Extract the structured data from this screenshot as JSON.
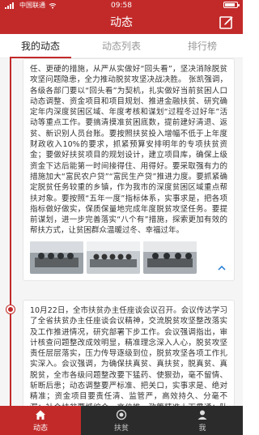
{
  "status_bar": {
    "carrier": "中国联通",
    "time": "09:58",
    "battery_percent": 85
  },
  "header": {
    "title": "动态"
  },
  "tabs": [
    {
      "label": "我的动态"
    },
    {
      "label": "动态列表"
    },
    {
      "label": "排行榜"
    }
  ],
  "posts": [
    {
      "text": "任、更硬的措施，从严从实做好“回头看”，坚决消除脱贫攻坚问题隐患，全力推动脱贫攻坚决战决胜。 张凯强调，各级各部门要以“回头看”为契机，扎实做好当前贫困人口动态调整、资金项目和项目规划、推进金融扶贫、研究确定年内深度贫困区域、年度考核和谋划“过程冬过好年”活动等重点工作。要搞清摸准贫困底数，提前建好清退、返贫、新识别人员台账。要按照扶贫投入增幅不低于上年度财政收入10%的要求，抓紧预算安排明年的专项扶贫资金；要做好扶贫项目的规划设计，建立项目库，确保上级资金下达后能第一时间接得住、用得好。要采取强有力的措施加大“富民农户贷”“富民生产贷”推进力度。要抓紧确定脱贫任务较重的乡镇，作为我市的深度贫困区域重点帮扶对象。要按照“五年一度”指标体系，实事求是，把各项指标做好做实，保质保量地完成年度脱贫攻坚任务。要提前谋划，进一步完善落实“八个有”措施，探索更加有效的帮扶方式，让贫困群众温暖过冬、幸福过年。",
      "images": [
        "meeting-photo-1",
        "meeting-photo-2",
        "meeting-photo-3"
      ]
    },
    {
      "text": "10月22日，全市扶贫办主任座谈会议召开。会议传达学习了全省扶贫办主任座谈会议精神，交流脱贫攻坚整改落实及工作推进情况，研究部署下步工作。会议强调指出，审计核查问题整改成效明显，精准理念深入人心，脱贫攻坚责任层层落实，压力传导逐级到位，脱贫攻坚各项工作扎实深入。会议强调，为确保扶真贫、真扶贫，脱真贫、真脱贫，全市各级问题整改要下猛药、使狠劲，毫不留情、斩断后患；动态调整要严标准、把关口，实事求是、绝对精准；资金项目要责任清、监管严，高效持久、分毫不漏；社会扶贫要抓综合、高位推，政策精准上下贯通；队伍建设要讲长远、协调"
    }
  ],
  "bottom_nav": [
    {
      "label": "动态",
      "icon": "home-icon"
    },
    {
      "label": "扶贫",
      "icon": "target-icon"
    },
    {
      "label": "我",
      "icon": "user-icon"
    }
  ],
  "colors": {
    "brand_red": "#c22a2a",
    "nav_dark": "#2b2b2b",
    "link_blue": "#1e79d3"
  }
}
